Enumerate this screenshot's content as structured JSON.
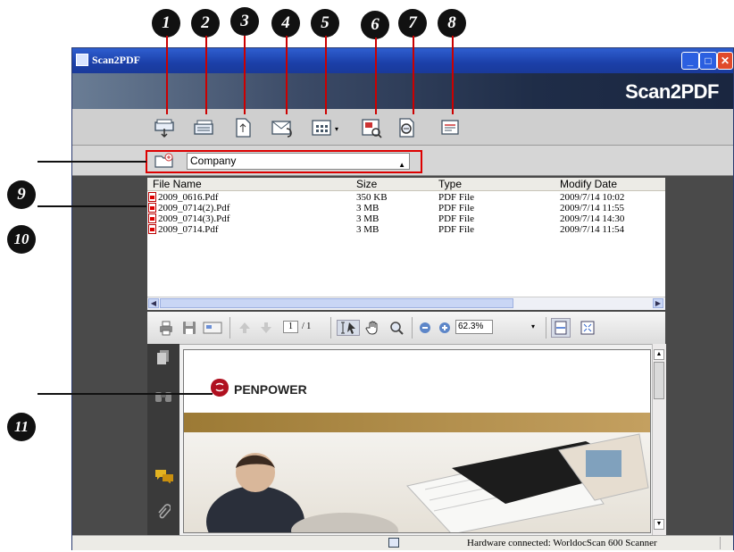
{
  "callouts": [
    "1",
    "2",
    "3",
    "4",
    "5",
    "6",
    "7",
    "8",
    "9",
    "10",
    "11"
  ],
  "window": {
    "title": "Scan2PDF",
    "brand": "Scan2PDF",
    "controls": [
      "minimize-icon",
      "maximize-icon",
      "close-icon"
    ]
  },
  "toolbar": {
    "buttons": [
      "scan-icon",
      "batch-scan-icon",
      "convert-pdf-icon",
      "email-attach-icon",
      "view-mode-icon",
      "preview-icon",
      "search-zoom-icon",
      "settings-icon"
    ]
  },
  "folder": {
    "selected": "Company",
    "icon": "open-folder-icon"
  },
  "file_list": {
    "headers": {
      "name": "File Name",
      "size": "Size",
      "type": "Type",
      "date": "Modify Date"
    },
    "rows": [
      {
        "name": "2009_0616.Pdf",
        "size": "350 KB",
        "type": "PDF File",
        "date": "2009/7/14 10:02"
      },
      {
        "name": "2009_0714(2).Pdf",
        "size": "3 MB",
        "type": "PDF File",
        "date": "2009/7/14 11:55"
      },
      {
        "name": "2009_0714(3).Pdf",
        "size": "3 MB",
        "type": "PDF File",
        "date": "2009/7/14 14:30"
      },
      {
        "name": "2009_0714.Pdf",
        "size": "3 MB",
        "type": "PDF File",
        "date": "2009/7/14 11:54"
      }
    ]
  },
  "viewer": {
    "page_current": "1",
    "page_total": "/ 1",
    "zoom": "62.3%",
    "doc_brand": "PENPOWER"
  },
  "status": {
    "text": "Hardware connected: WorldocScan 600 Scanner"
  },
  "colors": {
    "title_bar": "#1b3fa8",
    "highlight_box": "#dd0000",
    "brand_red": "#b01020"
  }
}
